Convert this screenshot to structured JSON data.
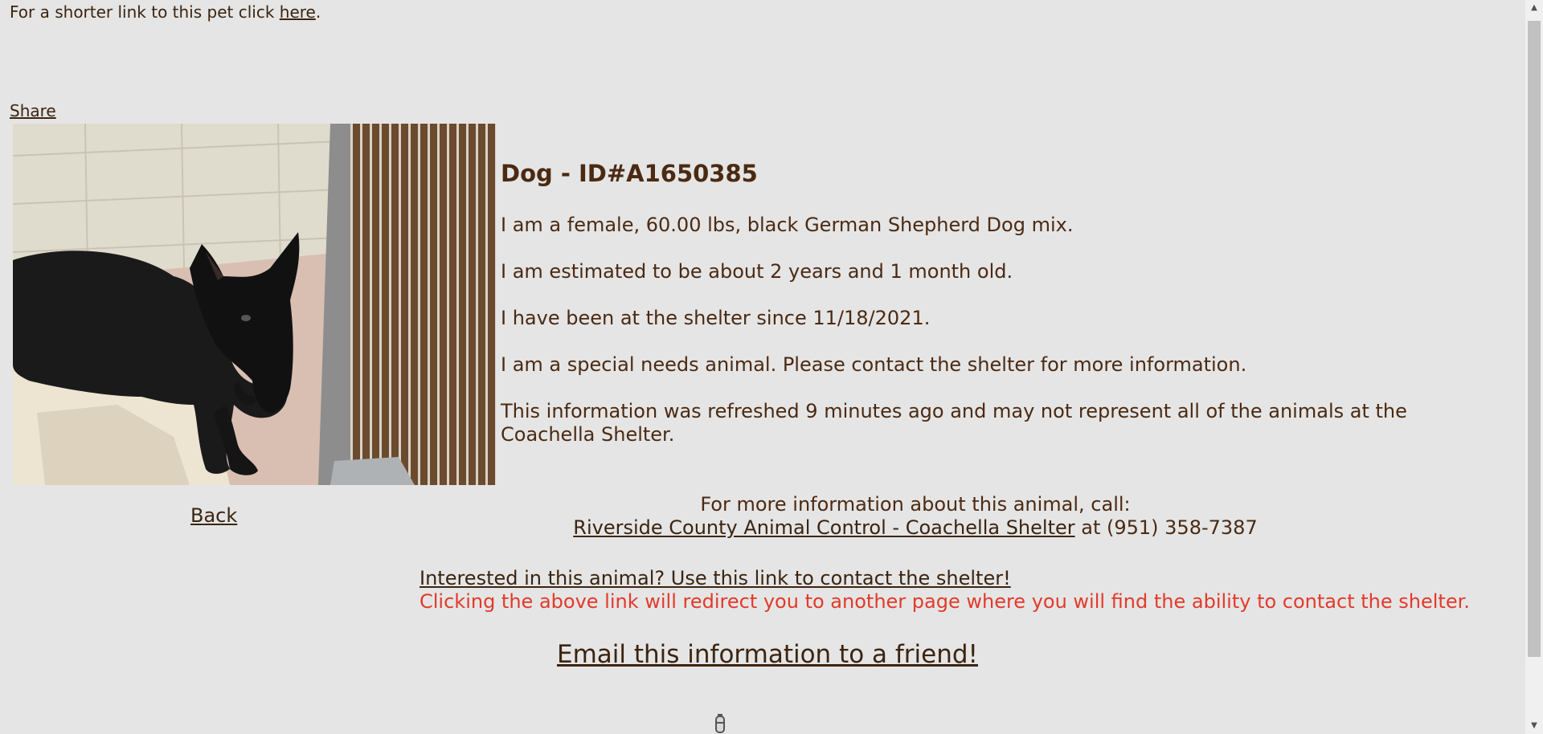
{
  "header": {
    "short_link_prefix": "For a shorter link to this pet click ",
    "short_link_label": "here",
    "short_link_suffix": ".",
    "share_label": "Share"
  },
  "animal": {
    "title": "Dog - ID#A1650385",
    "description": "I am a female, 60.00 lbs, black German Shepherd Dog mix.",
    "age": "I am estimated to be about 2 years and 1 month old.",
    "since": "I have been at the shelter since 11/18/2021.",
    "special_needs": "I am a special needs animal. Please contact the shelter for more information.",
    "refresh_note": "This information was refreshed 9 minutes ago and may not represent all of the animals at the Coachella Shelter.",
    "photo_icon": "dog-photo"
  },
  "navigation": {
    "back_label": "Back"
  },
  "contact": {
    "call_prompt": "For more information about this animal, call:",
    "shelter_name": "Riverside County Animal Control - Coachella Shelter",
    "phone_prefix": " at ",
    "phone": "(951) 358-7387",
    "interest_link": "Interested in this animal? Use this link to contact the shelter!",
    "redirect_note": "Clicking the above link will redirect you to another page where you will find the ability to contact the shelter.",
    "email_link": "Email this information to a friend!"
  },
  "colors": {
    "background": "#e5e5e5",
    "text": "#4b2a12",
    "warning": "#e23a2a"
  },
  "icons": {
    "spinner": "loading-spinner-icon",
    "scroll_up": "scroll-up-arrow-icon",
    "scroll_down": "scroll-down-arrow-icon"
  }
}
